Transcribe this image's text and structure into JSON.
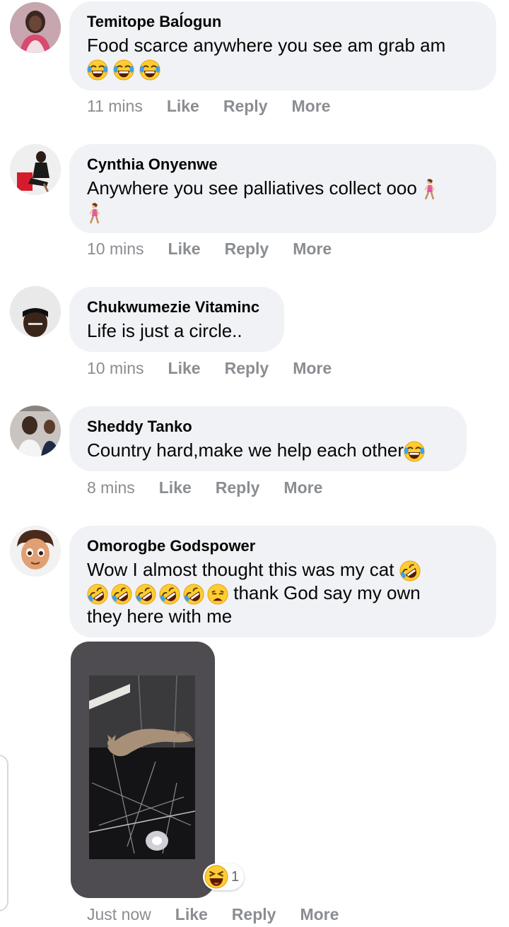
{
  "comments": [
    {
      "author": "Temitope Baĺogun",
      "text": "Food scarce anywhere you see am grab am",
      "time": "11 mins",
      "like": "Like",
      "reply": "Reply",
      "more": "More"
    },
    {
      "author": "Cynthia Onyenwe",
      "text": "Anywhere you see palliatives collect ooo",
      "time": "10 mins",
      "like": "Like",
      "reply": "Reply",
      "more": "More"
    },
    {
      "author": "Chukwumezie Vitaminc",
      "text": "Life is just a circle..",
      "time": "10 mins",
      "like": "Like",
      "reply": "Reply",
      "more": "More"
    },
    {
      "author": "Sheddy Tanko",
      "text": "Country hard,make we help each other",
      "time": "8 mins",
      "like": "Like",
      "reply": "Reply",
      "more": "More"
    },
    {
      "author": "Omorogbe Godspower",
      "text_line1": "Wow I almost thought this was my cat",
      "text_line2": "thank God say my own",
      "text_line3": "they here with me",
      "time": "Just now",
      "like": "Like",
      "reply": "Reply",
      "more": "More",
      "reaction_count": "1"
    }
  ],
  "icons": {
    "laugh": "tears-of-joy-emoji",
    "rofl": "rolling-on-floor-laughing-emoji",
    "walk": "woman-walking-emoji",
    "weary": "weary-face-emoji",
    "reaction": "haha-reaction-icon"
  }
}
